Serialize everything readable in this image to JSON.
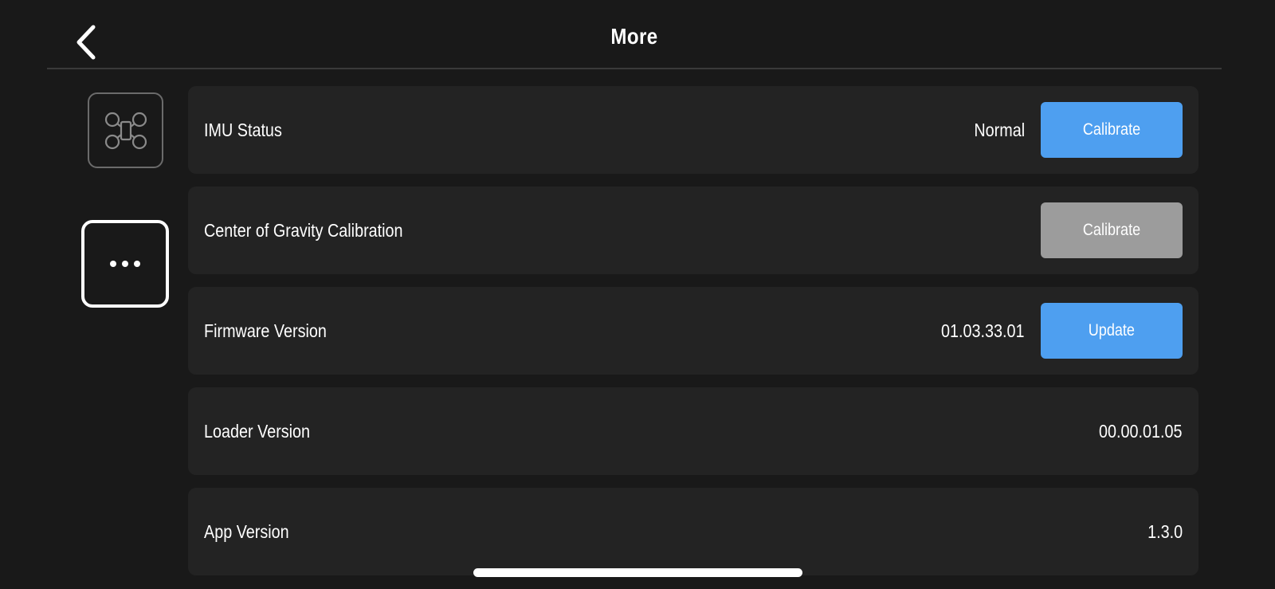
{
  "header": {
    "title": "More",
    "back_icon": "chevron-left-icon"
  },
  "sidebar": {
    "tabs": [
      {
        "icon": "drone-icon",
        "selected": false
      },
      {
        "icon": "more-dots-icon",
        "selected": true
      }
    ]
  },
  "rows": [
    {
      "label": "IMU Status",
      "value": "Normal",
      "button": {
        "label": "Calibrate",
        "enabled": true
      }
    },
    {
      "label": "Center of Gravity Calibration",
      "value": "",
      "button": {
        "label": "Calibrate",
        "enabled": false
      }
    },
    {
      "label": "Firmware Version",
      "value": "01.03.33.01",
      "button": {
        "label": "Update",
        "enabled": true
      }
    },
    {
      "label": "Loader Version",
      "value": "00.00.01.05"
    },
    {
      "label": "App Version",
      "value": "1.3.0"
    }
  ],
  "colors": {
    "background": "#191919",
    "row_background": "#232323",
    "accent_blue": "#4e9ff0",
    "disabled_gray": "#9c9c9c"
  }
}
